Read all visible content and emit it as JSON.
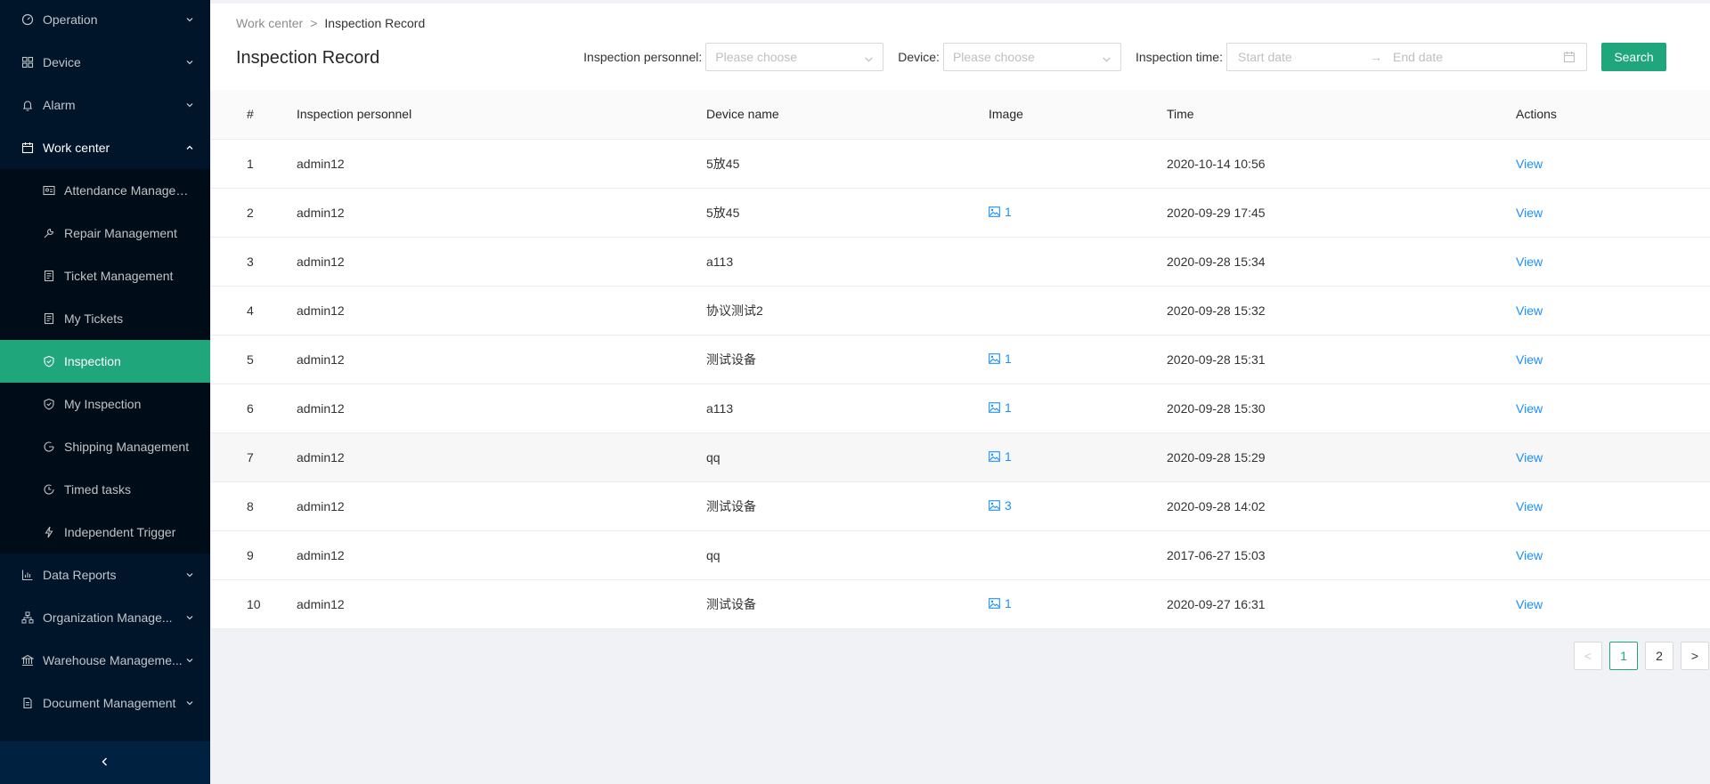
{
  "sidebar": {
    "items": [
      {
        "label": "Operation",
        "icon": "dashboard-icon"
      },
      {
        "label": "Device",
        "icon": "grid-icon"
      },
      {
        "label": "Alarm",
        "icon": "bell-icon"
      },
      {
        "label": "Work center",
        "icon": "calendar-icon"
      }
    ],
    "sub_items": [
      {
        "label": "Attendance Managem...",
        "icon": "id-card-icon"
      },
      {
        "label": "Repair Management",
        "icon": "wrench-icon"
      },
      {
        "label": "Ticket Management",
        "icon": "ticket-icon"
      },
      {
        "label": "My Tickets",
        "icon": "ticket-icon"
      },
      {
        "label": "Inspection",
        "icon": "shield-icon"
      },
      {
        "label": "My Inspection",
        "icon": "shield-icon"
      },
      {
        "label": "Shipping Management",
        "icon": "cycle-icon"
      },
      {
        "label": "Timed tasks",
        "icon": "clock-icon"
      },
      {
        "label": "Independent Trigger",
        "icon": "lightning-icon"
      }
    ],
    "bottom_items": [
      {
        "label": "Data Reports",
        "icon": "bar-chart-icon"
      },
      {
        "label": "Organization Manage...",
        "icon": "org-icon"
      },
      {
        "label": "Warehouse Manageme...",
        "icon": "bank-icon"
      },
      {
        "label": "Document Management",
        "icon": "file-icon"
      }
    ],
    "collapse_glyph": "‹"
  },
  "breadcrumb": {
    "parent": "Work center",
    "separator": ">",
    "current": "Inspection Record"
  },
  "page_title": "Inspection Record",
  "filters": {
    "personnel_label": "Inspection personnel:",
    "personnel_placeholder": "Please choose",
    "device_label": "Device:",
    "device_placeholder": "Please choose",
    "time_label": "Inspection time:",
    "start_placeholder": "Start date",
    "range_separator": "→",
    "end_placeholder": "End date",
    "search_label": "Search"
  },
  "table": {
    "columns": [
      "#",
      "Inspection personnel",
      "Device name",
      "Image",
      "Time",
      "Actions"
    ],
    "rows": [
      {
        "no": "1",
        "personnel": "admin12",
        "device": "5放45",
        "image": "",
        "time": "2020-10-14 10:56",
        "action": "View"
      },
      {
        "no": "2",
        "personnel": "admin12",
        "device": "5放45",
        "image": "1",
        "time": "2020-09-29 17:45",
        "action": "View"
      },
      {
        "no": "3",
        "personnel": "admin12",
        "device": "a113",
        "image": "",
        "time": "2020-09-28 15:34",
        "action": "View"
      },
      {
        "no": "4",
        "personnel": "admin12",
        "device": "协议测试2",
        "image": "",
        "time": "2020-09-28 15:32",
        "action": "View"
      },
      {
        "no": "5",
        "personnel": "admin12",
        "device": "测试设备",
        "image": "1",
        "time": "2020-09-28 15:31",
        "action": "View"
      },
      {
        "no": "6",
        "personnel": "admin12",
        "device": "a113",
        "image": "1",
        "time": "2020-09-28 15:30",
        "action": "View"
      },
      {
        "no": "7",
        "personnel": "admin12",
        "device": "qq",
        "image": "1",
        "time": "2020-09-28 15:29",
        "action": "View"
      },
      {
        "no": "8",
        "personnel": "admin12",
        "device": "测试设备",
        "image": "3",
        "time": "2020-09-28 14:02",
        "action": "View"
      },
      {
        "no": "9",
        "personnel": "admin12",
        "device": "qq",
        "image": "",
        "time": "2017-06-27 15:03",
        "action": "View"
      },
      {
        "no": "10",
        "personnel": "admin12",
        "device": "测试设备",
        "image": "1",
        "time": "2020-09-27 16:31",
        "action": "View"
      }
    ]
  },
  "pagination": {
    "prev": "<",
    "pages": [
      "1",
      "2"
    ],
    "current": "1",
    "next": ">"
  },
  "colors": {
    "accent": "#1fa67a",
    "link": "#1890ff",
    "sidebar_bg": "#001529"
  }
}
